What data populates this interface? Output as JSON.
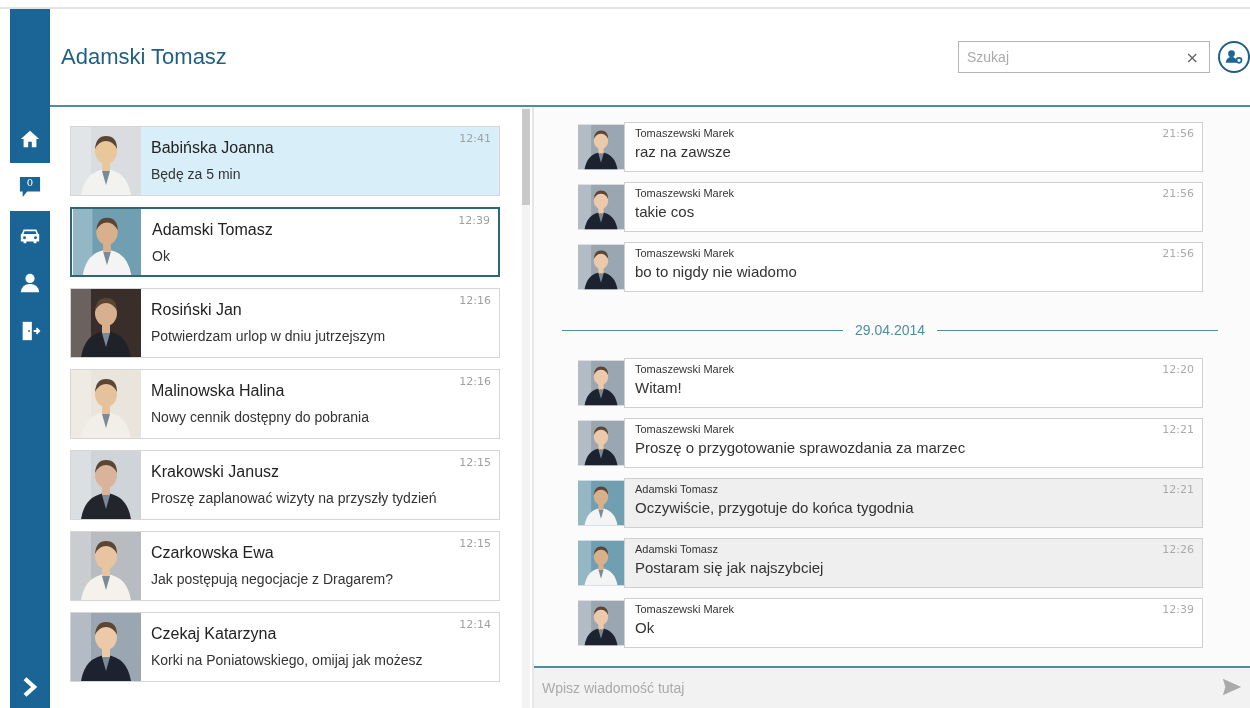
{
  "header": {
    "title": "Adamski Tomasz",
    "search": {
      "placeholder": "Szukaj",
      "clear": "×"
    }
  },
  "sidebar": {
    "items": [
      {
        "selected": false
      },
      {
        "selected": true,
        "badge": "0"
      },
      {
        "selected": false
      },
      {
        "selected": false
      },
      {
        "selected": false
      }
    ]
  },
  "contacts": [
    {
      "name": "Babińska Joanna",
      "message": "Będę za 5 min",
      "time": "12:41",
      "unread": true,
      "selected": false
    },
    {
      "name": "Adamski Tomasz",
      "message": "Ok",
      "time": "12:39",
      "unread": false,
      "selected": true
    },
    {
      "name": "Rosiński Jan",
      "message": "Potwierdzam urlop w dniu jutrzejszym",
      "time": "12:16",
      "unread": false,
      "selected": false
    },
    {
      "name": "Malinowska Halina",
      "message": "Nowy cennik dostępny do pobrania",
      "time": "12:16",
      "unread": false,
      "selected": false
    },
    {
      "name": "Krakowski Janusz",
      "message": "Proszę zaplanować wizyty na przyszły tydzień",
      "time": "12:15",
      "unread": false,
      "selected": false
    },
    {
      "name": "Czarkowska Ewa",
      "message": "Jak postępują negocjacje z Dragarem?",
      "time": "12:15",
      "unread": false,
      "selected": false
    },
    {
      "name": "Czekaj Katarzyna",
      "message": "Korki na Poniatowskiego, omijaj jak możesz",
      "time": "12:14",
      "unread": false,
      "selected": false
    }
  ],
  "messages": [
    {
      "kind": "message",
      "sender": "Tomaszewski Marek",
      "text": "raz na zawsze",
      "time": "21:56",
      "mine": false
    },
    {
      "kind": "message",
      "sender": "Tomaszewski Marek",
      "text": "takie cos",
      "time": "21:56",
      "mine": false
    },
    {
      "kind": "message",
      "sender": "Tomaszewski Marek",
      "text": "bo to nigdy nie wiadomo",
      "time": "21:56",
      "mine": false
    },
    {
      "kind": "date",
      "text": "29.04.2014"
    },
    {
      "kind": "message",
      "sender": "Tomaszewski Marek",
      "text": "Witam!",
      "time": "12:20",
      "mine": false
    },
    {
      "kind": "message",
      "sender": "Tomaszewski Marek",
      "text": "Proszę o przygotowanie sprawozdania za marzec",
      "time": "12:21",
      "mine": false
    },
    {
      "kind": "message",
      "sender": "Adamski Tomasz",
      "text": "Oczywiście, przygotuje do końca tygodnia",
      "time": "12:21",
      "mine": true
    },
    {
      "kind": "message",
      "sender": "Adamski Tomasz",
      "text": "Postaram się jak najszybciej",
      "time": "12:26",
      "mine": true
    },
    {
      "kind": "message",
      "sender": "Tomaszewski Marek",
      "text": "Ok",
      "time": "12:39",
      "mine": false
    }
  ],
  "composer": {
    "placeholder": "Wpisz wiadomość tutaj"
  }
}
